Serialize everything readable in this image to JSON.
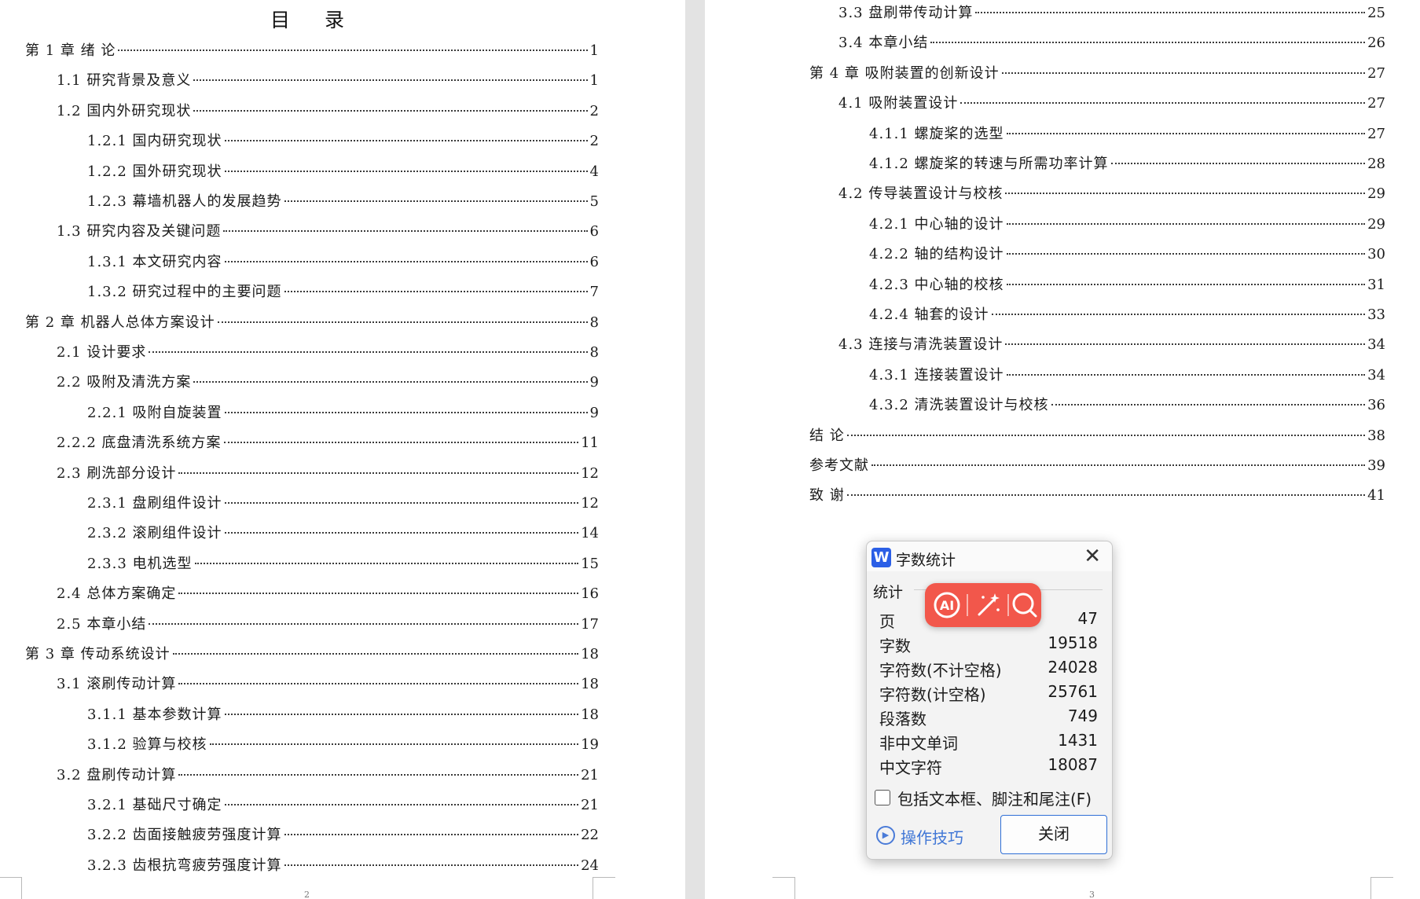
{
  "left_page": {
    "title": "目 录",
    "page_number": "2",
    "entries": [
      {
        "text": "第 1 章  绪  论",
        "page": "1"
      },
      {
        "text": "1.1  研究背景及意义",
        "page": "1"
      },
      {
        "text": "1.2  国内外研究现状",
        "page": "2"
      },
      {
        "text": "1.2.1  国内研究现状",
        "page": "2"
      },
      {
        "text": "1.2.2  国外研究现状",
        "page": "4"
      },
      {
        "text": "1.2.3  幕墙机器人的发展趋势",
        "page": "5"
      },
      {
        "text": "1.3  研究内容及关键问题",
        "page": "6"
      },
      {
        "text": "1.3.1  本文研究内容",
        "page": "6"
      },
      {
        "text": "1.3.2  研究过程中的主要问题",
        "page": "7"
      },
      {
        "text": "第 2 章  机器人总体方案设计",
        "page": "8"
      },
      {
        "text": "2.1  设计要求",
        "page": "8"
      },
      {
        "text": "2.2  吸附及清洗方案",
        "page": "9"
      },
      {
        "text": "2.2.1  吸附自旋装置",
        "page": "9"
      },
      {
        "text": "2.2.2  底盘清洗系统方案",
        "page": "11"
      },
      {
        "text": "2.3  刷洗部分设计",
        "page": "12"
      },
      {
        "text": "2.3.1  盘刷组件设计",
        "page": "12"
      },
      {
        "text": "2.3.2  滚刷组件设计",
        "page": "14"
      },
      {
        "text": "2.3.3  电机选型",
        "page": "15"
      },
      {
        "text": "2.4  总体方案确定",
        "page": "16"
      },
      {
        "text": "2.5  本章小结",
        "page": "17"
      },
      {
        "text": "第 3 章  传动系统设计",
        "page": "18"
      },
      {
        "text": "3.1  滚刷传动计算",
        "page": "18"
      },
      {
        "text": "3.1.1  基本参数计算",
        "page": "18"
      },
      {
        "text": "3.1.2  验算与校核",
        "page": "19"
      },
      {
        "text": "3.2  盘刷传动计算",
        "page": "21"
      },
      {
        "text": "3.2.1  基础尺寸确定",
        "page": "21"
      },
      {
        "text": "3.2.2  齿面接触疲劳强度计算",
        "page": "22"
      },
      {
        "text": "3.2.3  齿根抗弯疲劳强度计算",
        "page": "24"
      }
    ]
  },
  "right_page": {
    "page_number": "3",
    "entries": [
      {
        "text": "3.3  盘刷带传动计算",
        "page": "25"
      },
      {
        "text": "3.4  本章小结",
        "page": "26"
      },
      {
        "text": "第 4 章  吸附装置的创新设计",
        "page": "27"
      },
      {
        "text": "4.1  吸附装置设计",
        "page": "27"
      },
      {
        "text": "4.1.1  螺旋桨的选型",
        "page": "27"
      },
      {
        "text": "4.1.2  螺旋桨的转速与所需功率计算",
        "page": "28"
      },
      {
        "text": "4.2 传导装置设计与校核",
        "page": "29"
      },
      {
        "text": "4.2.1 中心轴的设计",
        "page": "29"
      },
      {
        "text": "4.2.2  轴的结构设计",
        "page": "30"
      },
      {
        "text": "4.2.3  中心轴的校核",
        "page": "31"
      },
      {
        "text": "4.2.4  轴套的设计",
        "page": "33"
      },
      {
        "text": "4.3 连接与清洗装置设计",
        "page": "34"
      },
      {
        "text": "4.3.1  连接装置设计",
        "page": "34"
      },
      {
        "text": "4.3.2  清洗装置设计与校核",
        "page": "36"
      },
      {
        "text": "结  论",
        "page": "38"
      },
      {
        "text": "参考文献",
        "page": "39"
      },
      {
        "text": "致  谢",
        "page": "41"
      }
    ]
  },
  "dialog": {
    "app_icon": "W",
    "title": "字数统计",
    "close_icon": "close-icon",
    "section_label": "统计信息",
    "section_label_visible": "统计",
    "stats": [
      {
        "label": "页数",
        "label_visible": "页",
        "value": "47"
      },
      {
        "label": "字数",
        "value": "19518"
      },
      {
        "label": "字符数(不计空格)",
        "value": "24028"
      },
      {
        "label": "字符数(计空格)",
        "value": "25761"
      },
      {
        "label": "段落数",
        "value": "749"
      },
      {
        "label": "非中文单词",
        "value": "1431"
      },
      {
        "label": "中文字符",
        "value": "18087"
      }
    ],
    "include_checkbox_label": "包括文本框、脚注和尾注(F)",
    "include_checked": false,
    "tips_label": "操作技巧",
    "close_button_label": "关闭"
  },
  "float_toolbar": {
    "buttons": [
      "ai-icon",
      "magic-wand-icon",
      "search-icon"
    ],
    "color": "#f2574b"
  }
}
